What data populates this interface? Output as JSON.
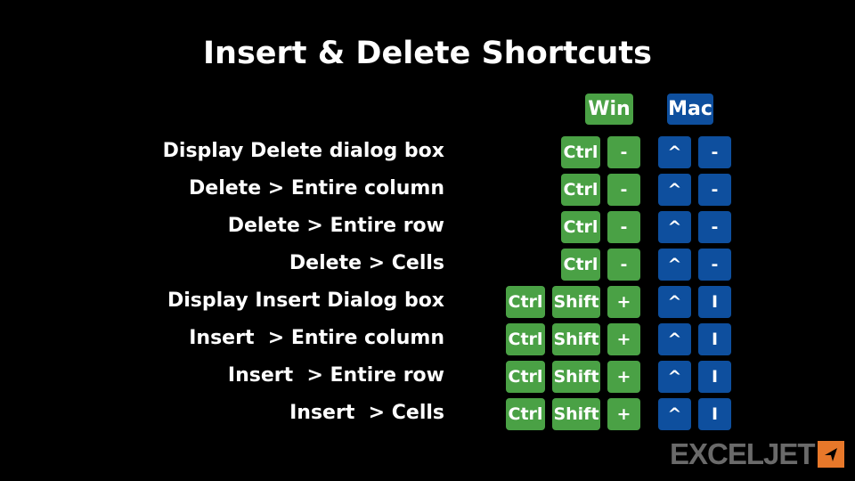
{
  "title": "Insert & Delete Shortcuts",
  "headers": {
    "win": "Win",
    "mac": "Mac"
  },
  "colors": {
    "win_key": "#4aa145",
    "mac_key": "#0e4f9e",
    "logo_text": "#6a6a6a",
    "logo_mark": "#e8782a"
  },
  "rows": [
    {
      "label": "Display Delete dialog box",
      "win": [
        "Ctrl",
        "-"
      ],
      "mac": [
        "^",
        "-"
      ]
    },
    {
      "label": "Delete > Entire column",
      "win": [
        "Ctrl",
        "-"
      ],
      "mac": [
        "^",
        "-"
      ]
    },
    {
      "label": "Delete > Entire row",
      "win": [
        "Ctrl",
        "-"
      ],
      "mac": [
        "^",
        "-"
      ]
    },
    {
      "label": "Delete > Cells",
      "win": [
        "Ctrl",
        "-"
      ],
      "mac": [
        "^",
        "-"
      ]
    },
    {
      "label": "Display Insert Dialog box",
      "win": [
        "Ctrl",
        "Shift",
        "+"
      ],
      "mac": [
        "^",
        "I"
      ]
    },
    {
      "label": "Insert  > Entire column",
      "win": [
        "Ctrl",
        "Shift",
        "+"
      ],
      "mac": [
        "^",
        "I"
      ]
    },
    {
      "label": "Insert  > Entire row",
      "win": [
        "Ctrl",
        "Shift",
        "+"
      ],
      "mac": [
        "^",
        "I"
      ]
    },
    {
      "label": "Insert  > Cells",
      "win": [
        "Ctrl",
        "Shift",
        "+"
      ],
      "mac": [
        "^",
        "I"
      ]
    }
  ],
  "logo": {
    "text": "EXCELJET",
    "icon": "arrow-cursor-icon"
  }
}
